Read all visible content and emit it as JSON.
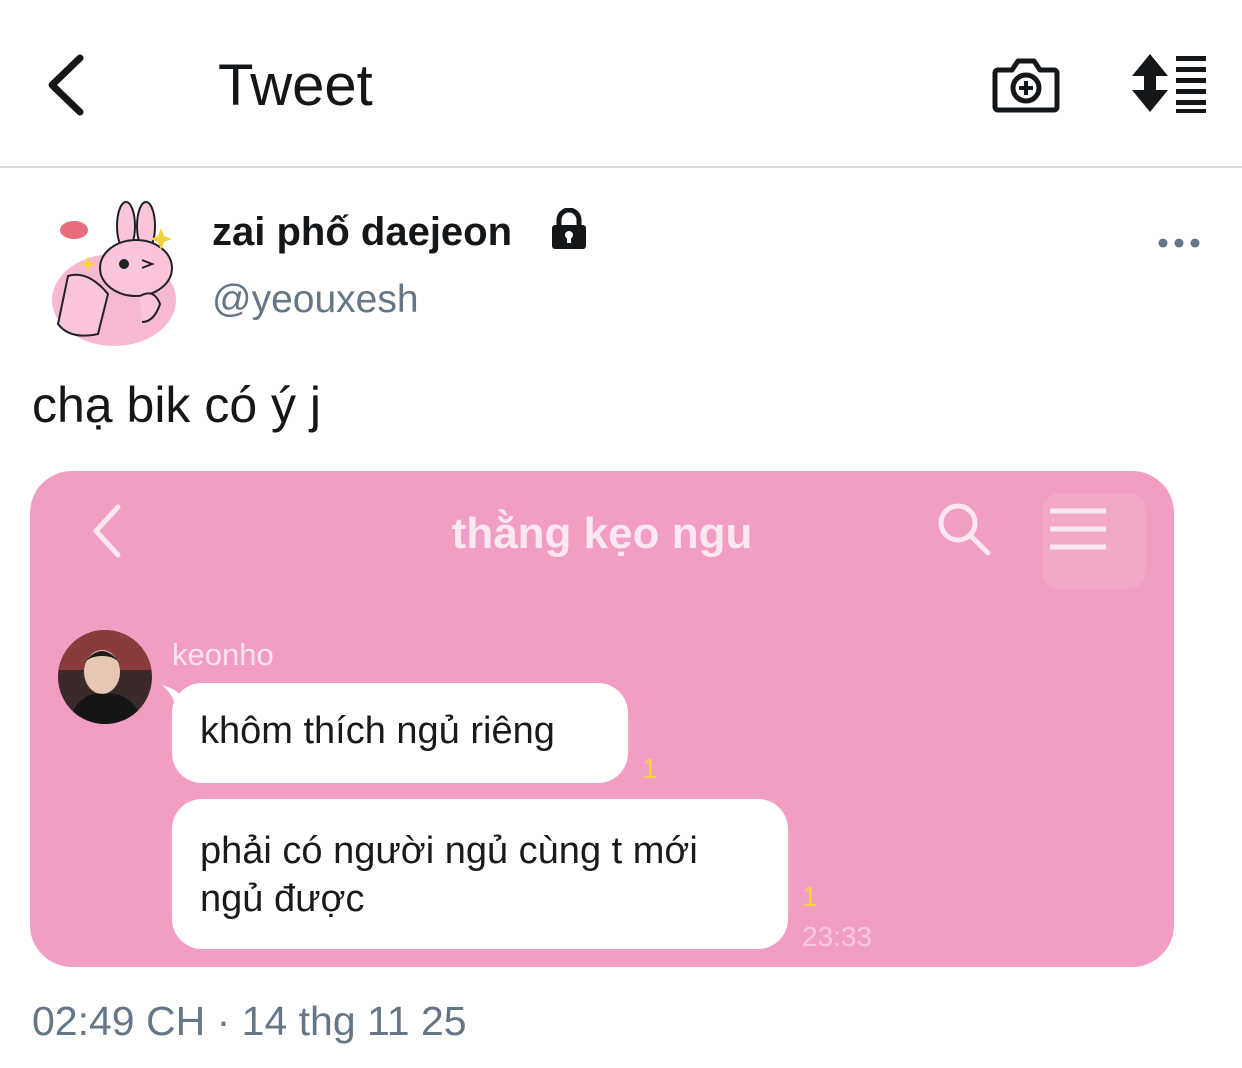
{
  "header": {
    "title": "Tweet",
    "back_icon": "chevron-left-icon",
    "camera_icon": "camera-add-icon",
    "sort_icon": "sort-list-icon"
  },
  "tweet": {
    "display_name": "zai phố daejeon",
    "handle": "@yeouxesh",
    "text": "chạ bik có ý j",
    "timestamp": "02:49 CH · 14 thg 11 25",
    "locked_icon": "lock-icon",
    "more_icon": "more-dots-icon"
  },
  "screenshot": {
    "chat_title": "thằng kẹo ngu",
    "sender_name": "keonho",
    "messages": [
      {
        "text_line1": "khôm thích ngủ riêng",
        "read_count": "1"
      },
      {
        "text_line1": "phải có người ngủ cùng t mới",
        "text_line2": "ngủ được",
        "read_count": "1",
        "time": "23:33"
      }
    ],
    "background_color": "#f29ec4"
  }
}
